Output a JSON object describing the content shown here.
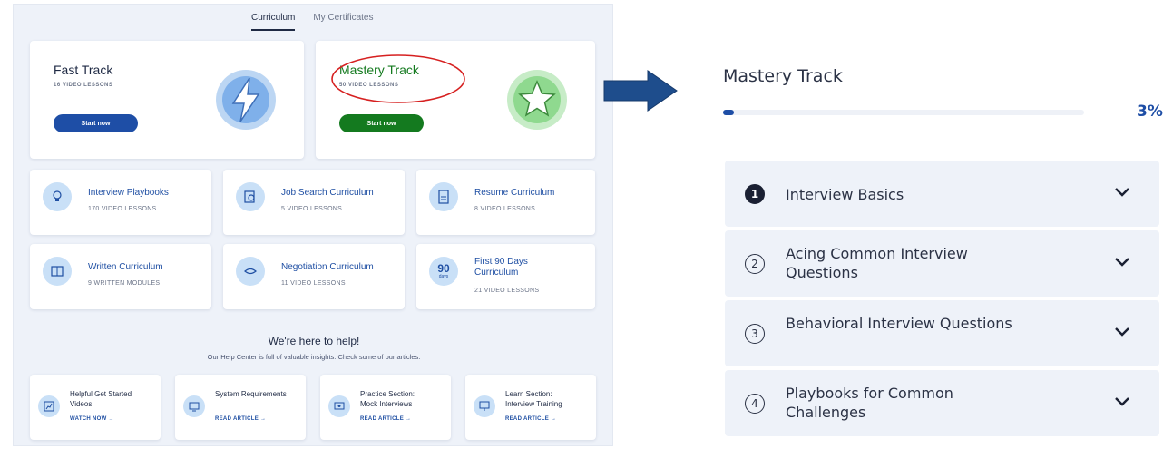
{
  "tabs": {
    "curriculum": "Curriculum",
    "certificates": "My Certificates"
  },
  "tracks": {
    "fast": {
      "title": "Fast Track",
      "sub": "16 VIDEO LESSONS",
      "button": "Start now",
      "color": "#1e4ea6"
    },
    "mastery": {
      "title": "Mastery Track",
      "sub": "50 VIDEO LESSONS",
      "button": "Start now",
      "color": "#147a1f"
    }
  },
  "curricula": [
    {
      "title": "Interview Playbooks",
      "sub": "170 VIDEO LESSONS"
    },
    {
      "title": "Job Search Curriculum",
      "sub": "5 VIDEO LESSONS"
    },
    {
      "title": "Resume Curriculum",
      "sub": "8 VIDEO LESSONS"
    },
    {
      "title": "Written Curriculum",
      "sub": "9 WRITTEN MODULES"
    },
    {
      "title": "Negotiation Curriculum",
      "sub": "11 VIDEO LESSONS"
    },
    {
      "title": "First 90 Days Curriculum",
      "sub": "21 VIDEO LESSONS",
      "badge_num": "90",
      "badge_unit": "days"
    }
  ],
  "help": {
    "title": "We're here to help!",
    "subtitle": "Our Help Center is full of valuable insights. Check some of our articles.",
    "articles": [
      {
        "title": "Helpful Get Started Videos",
        "action": "WATCH NOW →"
      },
      {
        "title": "System Requirements",
        "action": "READ ARTICLE →"
      },
      {
        "title": "Practice Section: Mock Interviews",
        "action": "READ ARTICLE →"
      },
      {
        "title": "Learn Section: Interview Training",
        "action": "READ ARTICLE →"
      }
    ]
  },
  "detail": {
    "title": "Mastery Track",
    "progress_percent": 3,
    "progress_label": "3%",
    "sections": [
      {
        "num": "1",
        "label": "Interview Basics",
        "active": true
      },
      {
        "num": "2",
        "label": "Acing Common Interview Questions",
        "active": false
      },
      {
        "num": "3",
        "label": "Behavioral Interview Questions",
        "active": false
      },
      {
        "num": "4",
        "label": "Playbooks for Common Challenges",
        "active": false
      }
    ]
  },
  "colors": {
    "accent": "#1e4ea6",
    "success": "#147a1f",
    "highlight": "#d62020",
    "arrow": "#1e4d8c"
  }
}
